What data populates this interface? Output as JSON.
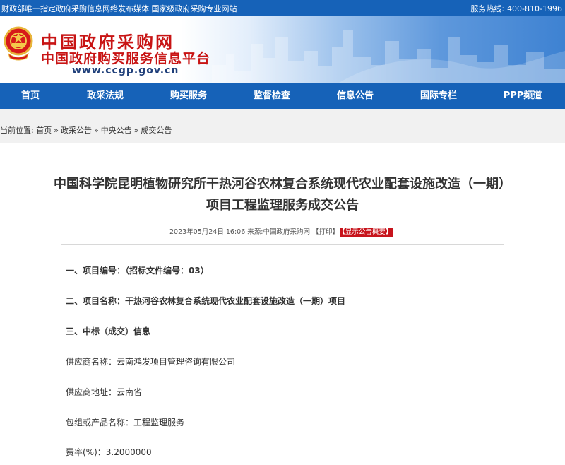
{
  "topbar": {
    "slogan": "财政部唯一指定政府采购信息网络发布媒体 国家级政府采购专业网站",
    "hotline_label": "服务热线:",
    "hotline_number": "400-810-1996"
  },
  "header": {
    "title": "中国政府采购网",
    "subtitle": "中国政府购买服务信息平台",
    "url": "www.ccgp.gov.cn",
    "emblem_icon": "national-emblem-icon"
  },
  "nav": {
    "items": [
      "首页",
      "政采法规",
      "购买服务",
      "监督检查",
      "信息公告",
      "国际专栏",
      "PPP频道"
    ]
  },
  "breadcrumb": {
    "prefix": "当前位置:",
    "items": [
      "首页",
      "政采公告",
      "中央公告",
      "成交公告"
    ],
    "separator": "»"
  },
  "article": {
    "title_line1": "中国科学院昆明植物研究所干热河谷农林复合系统现代农业配套设施改造（一期）",
    "title_line2": "项目工程监理服务成交公告",
    "meta": {
      "datetime": "2023年05月24日 16:06",
      "source_label": "来源:",
      "source": "中国政府采购网",
      "print": "【打印】",
      "summary": "【显示公告概要】"
    },
    "lines": [
      "一、项目编号：（招标文件编号：03）",
      "二、项目名称：干热河谷农林复合系统现代农业配套设施改造（一期）项目",
      "三、中标（成交）信息",
      "供应商名称：云南鸿发项目管理咨询有限公司",
      "供应商地址：云南省",
      "包组或产品名称：工程监理服务",
      "费率(%)：3.2000000"
    ]
  },
  "colors": {
    "brand_blue": "#1662b8",
    "title_red": "#c81414",
    "summary_red": "#c7141c"
  }
}
